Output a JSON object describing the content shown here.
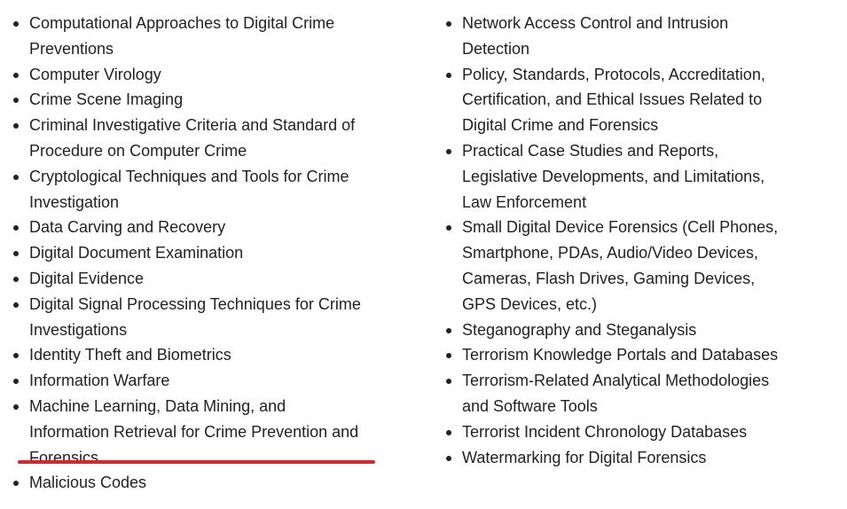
{
  "colors": {
    "text": "#222222",
    "annotation_line": "#e0222e",
    "background": "#ffffff"
  },
  "left_list": [
    "Computational Approaches to Digital Crime Preventions",
    "Computer Virology",
    "Crime Scene Imaging",
    "Criminal Investigative Criteria and Standard of Procedure on Computer Crime",
    "Cryptological Techniques and Tools for Crime Investigation",
    "Data Carving and Recovery",
    "Digital Document Examination",
    "Digital Evidence",
    "Digital Signal Processing Techniques for Crime Investigations",
    "Identity Theft and Biometrics",
    "Information Warfare",
    "Machine Learning, Data Mining, and Information Retrieval for Crime Prevention and Forensics",
    "Malicious Codes"
  ],
  "right_list": [
    "Network Access Control and Intrusion Detection",
    "Policy, Standards, Protocols, Accreditation, Certification, and Ethical Issues Related to Digital Crime and Forensics",
    "Practical Case Studies and Reports, Legislative Developments, and Limitations, Law Enforcement",
    "Small Digital Device Forensics (Cell Phones, Smartphone, PDAs, Audio/Video Devices, Cameras, Flash Drives, Gaming Devices, GPS Devices, etc.)",
    "Steganography and Steganalysis",
    "Terrorism Knowledge Portals and Databases",
    "Terrorism-Related Analytical Methodologies and Software Tools",
    "Terrorist Incident Chronology Databases",
    "Watermarking for Digital Forensics"
  ]
}
